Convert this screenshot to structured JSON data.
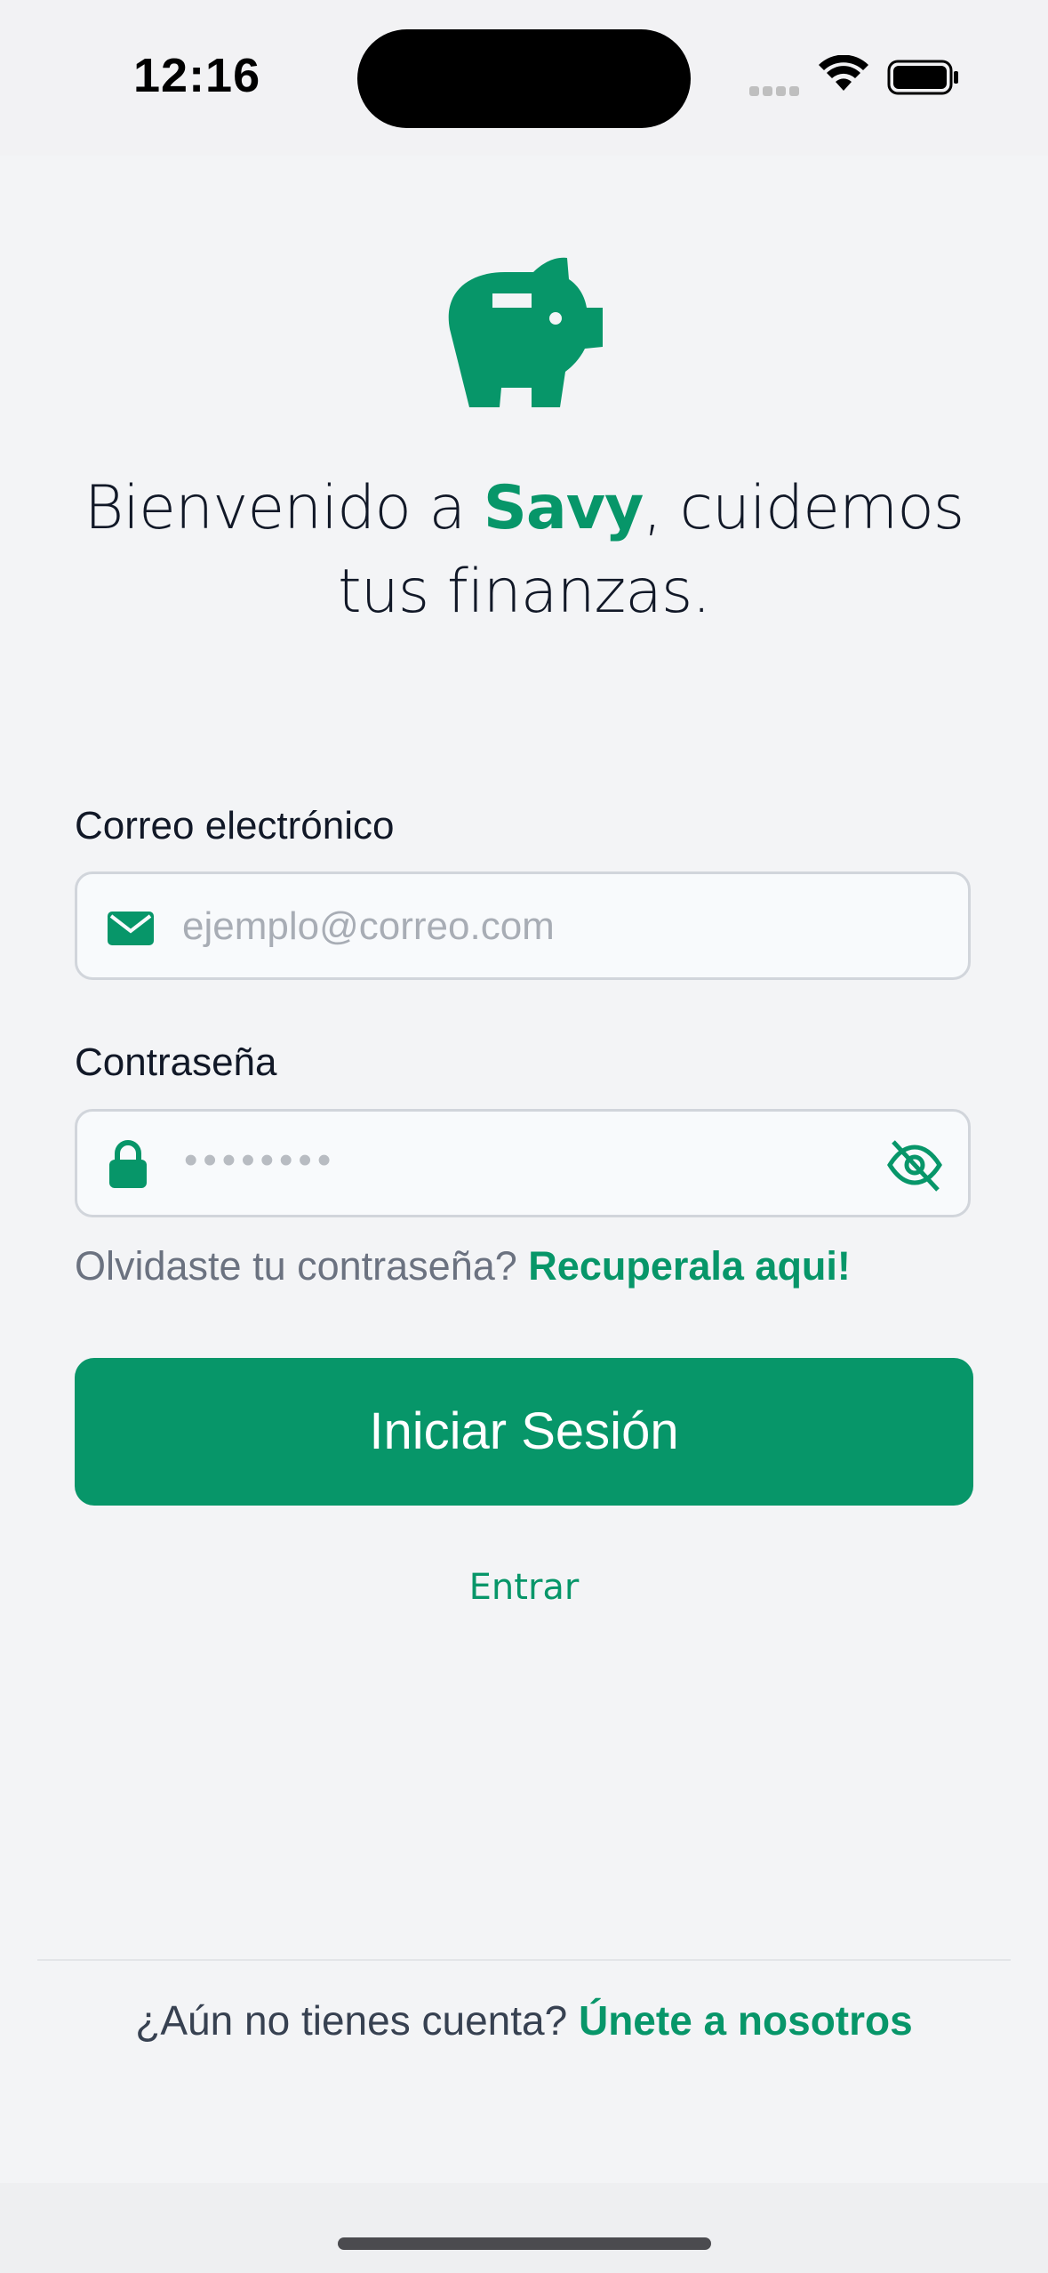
{
  "status_bar": {
    "time": "12:16"
  },
  "brand": {
    "logo_icon": "piggy-bank-icon",
    "accent_color": "#079669"
  },
  "headline": {
    "prefix": "Bienvenido a ",
    "brand": "Savy",
    "suffix": ", cuidemos tus finanzas."
  },
  "email": {
    "label": "Correo electrónico",
    "placeholder": "ejemplo@correo.com",
    "icon": "mail-icon"
  },
  "password": {
    "label": "Contraseña",
    "placeholder": "••••••••",
    "icon": "lock-icon",
    "toggle_icon": "eye-off-icon"
  },
  "forgot": {
    "text": "Olvidaste tu contraseña? ",
    "link": "Recuperala aqui!"
  },
  "login_button": {
    "label": "Iniciar Sesión"
  },
  "enter_link": {
    "label": "Entrar"
  },
  "footer": {
    "text": "¿Aún no tienes cuenta? ",
    "link": "Únete a nosotros"
  }
}
